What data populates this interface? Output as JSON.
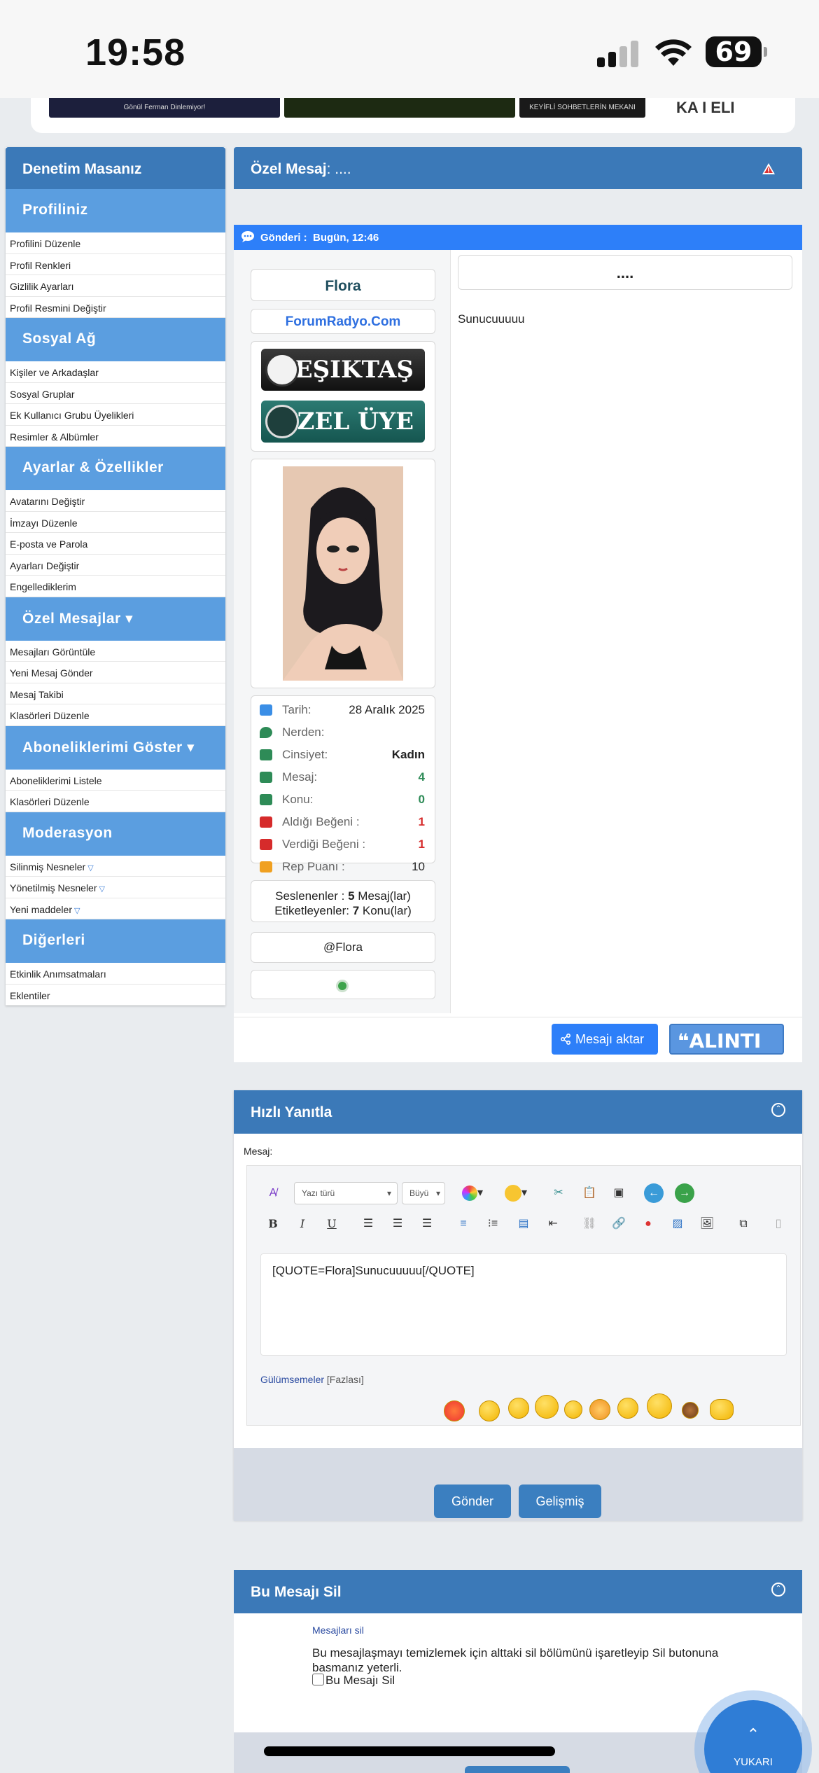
{
  "status": {
    "time": "19:58",
    "battery": "69"
  },
  "banners": {
    "b1": "Gönül Ferman Dinlemiyor!",
    "b3": "KEYİFLİ SOHBETLERİN MEKANI",
    "b4": "KA I ELI"
  },
  "sidebar": {
    "title": "Denetim Masanız",
    "sections": [
      {
        "heading": "Profiliniz",
        "items": [
          "Profilini Düzenle",
          "Profil Renkleri",
          "Gizlilik Ayarları",
          "Profil Resmini Değiştir"
        ]
      },
      {
        "heading": "Sosyal Ağ",
        "items": [
          "Kişiler ve Arkadaşlar",
          "Sosyal Gruplar",
          "Ek Kullanıcı Grubu Üyelikleri",
          "Resimler & Albümler"
        ]
      },
      {
        "heading": "Ayarlar & Özellikler",
        "items": [
          "Avatarını Değiştir",
          "İmzayı Düzenle",
          "E-posta ve Parola",
          "Ayarları Değiştir",
          "Engellediklerim"
        ]
      },
      {
        "heading": "Özel Mesajlar ▾",
        "items": [
          "Mesajları Görüntüle",
          "Yeni Mesaj Gönder",
          "Mesaj Takibi",
          "Klasörleri Düzenle"
        ]
      },
      {
        "heading": "Aboneliklerimi Göster ▾",
        "items": [
          "Aboneliklerimi Listele",
          "Klasörleri Düzenle"
        ]
      },
      {
        "heading": "Moderasyon",
        "items": [
          "Silinmiş Nesneler",
          "Yönetilmiş Nesneler",
          "Yeni maddeler"
        ]
      },
      {
        "heading": "Diğerleri",
        "items": [
          "Etkinlik Anımsatmaları",
          "Eklentiler"
        ]
      }
    ]
  },
  "pm": {
    "header_label": "Özel Mesaj",
    "header_title": ": ....",
    "sent_label": "Gönderi :",
    "sent_time": "Bugün, 12:46",
    "title": "....",
    "body": "Sunucuuuuu"
  },
  "user": {
    "name": "Flora",
    "site": "ForumRadyo.Com",
    "badge1": "BEŞIKTAŞ",
    "badge2": "ÖZEL ÜYE",
    "stats": [
      {
        "label": "Tarih:",
        "value": "28 Aralık 2025",
        "color": "dark",
        "icon": "user-plus-icon"
      },
      {
        "label": "Nerden:",
        "value": "",
        "color": "dark",
        "icon": "location-pin-icon"
      },
      {
        "label": "Cinsiyet:",
        "value": "Kadın",
        "color": "bold",
        "icon": "gender-icon"
      },
      {
        "label": "Mesaj:",
        "value": "4",
        "color": "green",
        "icon": "comment-icon"
      },
      {
        "label": "Konu:",
        "value": "0",
        "color": "green",
        "icon": "clipboard-icon"
      },
      {
        "label": "Aldığı Beğeni :",
        "value": "1",
        "color": "red",
        "icon": "thumbs-up-icon"
      },
      {
        "label": "Verdiği Beğeni :",
        "value": "1",
        "color": "red",
        "icon": "thumbs-down-icon"
      },
      {
        "label": "Rep Puanı :",
        "value": "10",
        "color": "dark",
        "icon": "share-icon"
      }
    ],
    "seslenen_line1_a": "Seslenenler : ",
    "seslenen_count": "5",
    "seslenen_line1_b": " Mesaj(lar)",
    "etiket_a": "Etiketleyenler: ",
    "etiket_count": "7",
    "etiket_b": " Konu(lar)",
    "mention": "@Flora"
  },
  "actions": {
    "share": "Mesajı aktar",
    "quote": "ALINTI"
  },
  "quick_reply": {
    "title": "Hızlı Yanıtla",
    "mesaj_label": "Mesaj:",
    "font_select": "Yazı türü",
    "size_select": "Büyü",
    "content": "[QUOTE=Flora]Sunucuuuuu[/QUOTE]",
    "smilies": "Gülümsemeler",
    "more": "[Fazlası]",
    "send": "Gönder",
    "advanced": "Gelişmiş"
  },
  "delete": {
    "title": "Bu Mesajı Sil",
    "sub": "Mesajları sil",
    "text": "Bu mesajlaşmayı temizlemek için alttaki sil bölümünü işaretleyip Sil butonuna basmanız yeterli.",
    "checkbox": "Bu Mesajı Sil"
  },
  "scroll_top": "YUKARI",
  "colors": {
    "header": "#3b79b8",
    "section": "#5b9ee0",
    "accent": "#2d7ff9"
  }
}
